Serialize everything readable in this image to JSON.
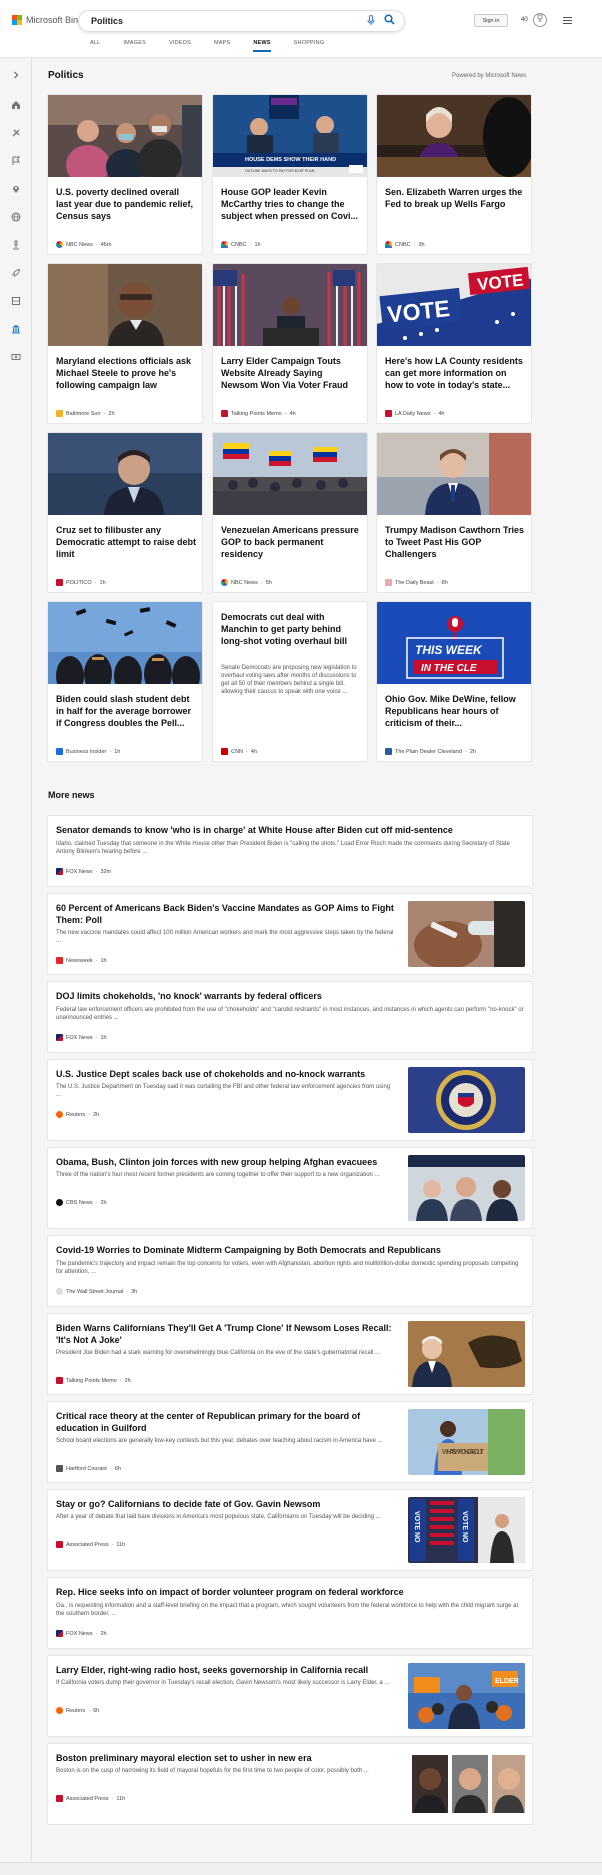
{
  "header": {
    "logo_text": "Microsoft Bing",
    "search_value": "Politics",
    "tabs": [
      "ALL",
      "IMAGES",
      "VIDEOS",
      "MAPS",
      "NEWS",
      "SHOPPING"
    ],
    "active_tab": "NEWS",
    "sign_in": "Sign in",
    "points": "40"
  },
  "main": {
    "section_title": "Politics",
    "powered_by": "Powered by Microsoft News",
    "cards": [
      {
        "title": "U.S. poverty declined overall last year due to pandemic relief, Census says",
        "source": "NBC News",
        "time": "46m"
      },
      {
        "title": "House GOP leader Kevin McCarthy tries to change the subject when pressed on Covi...",
        "source": "CNBC",
        "time": "1h"
      },
      {
        "title": "Sen. Elizabeth Warren urges the Fed to break up Wells Fargo",
        "source": "CNBC",
        "time": "3h"
      },
      {
        "title": "Maryland elections officials ask Michael Steele to prove he's following campaign law",
        "source": "Baltimore Sun",
        "time": "2h"
      },
      {
        "title": "Larry Elder Campaign Touts Website Already Saying Newsom Won Via Voter Fraud",
        "source": "Talking Points Memo",
        "time": "4h"
      },
      {
        "title": "Here's how LA County residents can get more information on how to vote in today's state...",
        "source": "LA Daily News",
        "time": "4h"
      },
      {
        "title": "Cruz set to filibuster any Democratic attempt to raise debt limit",
        "source": "POLITICO",
        "time": "1h"
      },
      {
        "title": "Venezuelan Americans pressure GOP to back permanent residency",
        "source": "NBC News",
        "time": "5h"
      },
      {
        "title": "Trumpy Madison Cawthorn Tries to Tweet Past His GOP Challengers",
        "source": "The Daily Beast",
        "time": "8h"
      },
      {
        "title": "Biden could slash student debt in half for the average borrower if Congress doubles the Pell...",
        "source": "Business Insider",
        "time": "1h"
      },
      {
        "title": "Democrats cut deal with Manchin to get party behind long-shot voting overhaul bill",
        "snippet": "Senate Democrats are proposing new legislation to overhaul voting laws after months of discussions to get all 50 of their members behind a single bill, allowing their caucus to speak with one voice ...",
        "source": "CNN",
        "time": "4h"
      },
      {
        "title": "Ohio Gov. Mike DeWine, fellow Republicans hear hours of criticism of their...",
        "source": "The Plain Dealer Cleveland",
        "time": "2h"
      }
    ],
    "tile_text": {
      "house_dems_banner": "HOUSE DEMS SHOW THEIR HAND",
      "house_dems_sub": "OUTLINE WAYS TO PAY FOR $3.5T PLAN",
      "vote": "VOTE",
      "this_week": "THIS WEEK",
      "in_the_cle": "IN THE CLE"
    },
    "more_title": "More news",
    "more": [
      {
        "title": "Senator demands to know 'who is in charge' at White House after Biden cut off mid-sentence",
        "snippet": "Idaho, claimed Tuesday that someone in the White House other than President Biden is \"calling the shots.\" Load Error Risch made the comments during Secretary of State Antony Blinken's hearing before ...",
        "source": "FOX News",
        "time": "32m"
      },
      {
        "title": "60 Percent of Americans Back Biden's Vaccine Mandates as GOP Aims to Fight Them: Poll",
        "snippet": "The new vaccine mandates could affect 100 million American workers and mark the most aggressive steps taken by the federal ...",
        "source": "Newsweek",
        "time": "1h"
      },
      {
        "title": "DOJ limits chokeholds, 'no knock' warrants by federal officers",
        "snippet": "Federal law enforcement officers are prohibited from the use of \"chokeholds\" and \"carotid restraints\" in most instances, and instances in which agents can perform \"no-knock\" or unannounced entries ...",
        "source": "FOX News",
        "time": "1h"
      },
      {
        "title": "U.S. Justice Dept scales back use of chokeholds and no-knock warrants",
        "snippet": "The U.S. Justice Department on Tuesday said it was curtailing the FBI and other federal law enforcement agencies from using ...",
        "source": "Reuters",
        "time": "2h"
      },
      {
        "title": "Obama, Bush, Clinton join forces with new group helping Afghan evacuees",
        "snippet": "Three of the nation's four most recent former presidents are coming together to offer their support to a new organization ...",
        "source": "CBS News",
        "time": "2h"
      },
      {
        "title": "Covid-19 Worries to Dominate Midterm Campaigning by Both Democrats and Republicans",
        "snippet": "The pandemic's trajectory and impact remain the top concerns for voters, even with Afghanistan, abortion rights and multitrillion-dollar domestic spending proposals competing for attention, ...",
        "source": "The Wall Street Journal",
        "time": "3h"
      },
      {
        "title": "Biden Warns Californians They'll Get A 'Trump Clone' If Newsom Loses Recall: 'It's Not A Joke'",
        "snippet": "President Joe Biden had a stark warning for overwhelmingly blue California on the eve of the state's gubernatorial recall ...",
        "source": "Talking Points Memo",
        "time": "2h"
      },
      {
        "title": "Critical race theory at the center of Republican primary for the board of education in Guilford",
        "snippet": "School board elections are generally low-key contests but this year, debates over teaching about racism in America have ...",
        "source": "Hartford Courant",
        "time": "6h"
      },
      {
        "title": "Stay or go? Californians to decide fate of Gov. Gavin Newsom",
        "snippet": "After a year of debate that laid bare divisions in America's most populous state, Californians on Tuesday will be deciding ...",
        "source": "Associated Press",
        "time": "11h"
      },
      {
        "title": "Rep. Hice seeks info on impact of border volunteer program on federal workforce",
        "snippet": "Ga., is requesting information and a staff-level briefing on the impact that a program, which sought volunteers from the federal workforce to help with the child migrant surge at the southern border, ...",
        "source": "FOX News",
        "time": "2h"
      },
      {
        "title": "Larry Elder, right-wing radio host, seeks governorship in California recall",
        "snippet": "If California voters dump their governor in Tuesday's recall election, Gavin Newsom's most likely successor is Larry Elder, a ...",
        "source": "Reuters",
        "time": "6h"
      },
      {
        "title": "Boston preliminary mayoral election set to usher in new era",
        "snippet": "Boston is on the cusp of narrowing its field of mayoral hopefuls for the first time to two people of color, possibly both ...",
        "source": "Associated Press",
        "time": "11h"
      }
    ],
    "more_image_text": {
      "whats_wrong": "WHAT'S WRONG ABOUT",
      "voteno": "VOTE NO",
      "elder": "ELDER"
    }
  },
  "colors": {
    "accent": "#0f6cbd",
    "background": "#f5f5f5"
  }
}
